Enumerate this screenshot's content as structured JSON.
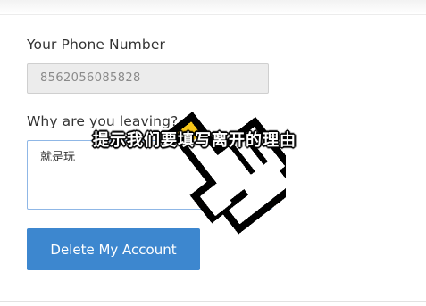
{
  "form": {
    "phone_label": "Your Phone Number",
    "phone_value": "8562056085828",
    "reason_label": "Why are you leaving?",
    "reason_value": "就是玩",
    "delete_button_label": "Delete My Account"
  },
  "overlay": {
    "subtitle": "提示我们要填写离开的理由",
    "cursor_icon": "pixel-hand-pointer-icon",
    "cursor_accent_color": "#f5c518"
  },
  "colors": {
    "button_bg": "#3d87cf",
    "button_text": "#ffffff",
    "label_text": "#333333",
    "readonly_field_bg": "#ececec",
    "focus_border": "#8fb7e6"
  }
}
